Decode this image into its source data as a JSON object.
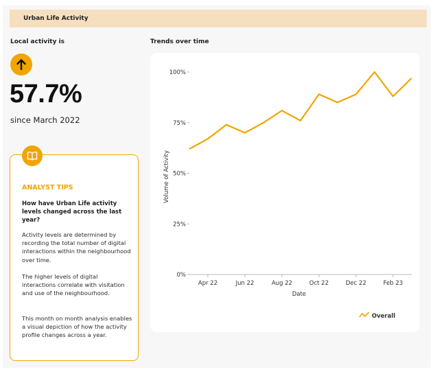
{
  "header": {
    "title": "Urban Life Activity"
  },
  "activity": {
    "label": "Local activity is",
    "direction_icon": "arrow-up-icon",
    "value": "57.7%",
    "since": "since March 2022"
  },
  "tips": {
    "icon": "book-icon",
    "title": "ANALYST TIPS",
    "question": "How have Urban Life activity levels changed across the last year?",
    "paragraphs": [
      "Activity levels are determined by recording the total number of digital interactions within the neighbourhood over time.",
      "The higher levels of digital interactions correlate with visitation and use of the neighbourhood.",
      "This month on month analysis enables a visual depiction of how the activity profile changes across a year."
    ]
  },
  "chart_section": {
    "label": "Trends over time"
  },
  "colors": {
    "accent": "#f0a500",
    "header_bg": "#f6dfbf",
    "panel_bg": "#f7f7f7"
  },
  "chart_data": {
    "type": "line",
    "xlabel": "Date",
    "ylabel": "Volume of Activity",
    "x": [
      "Mar 22",
      "Apr 22",
      "May 22",
      "Jun 22",
      "Jul 22",
      "Aug 22",
      "Sep 22",
      "Oct 22",
      "Nov 22",
      "Dec 22",
      "Jan 23",
      "Feb 23",
      "Mar 23"
    ],
    "x_ticks": [
      "Apr 22",
      "Jun 22",
      "Aug 22",
      "Oct 22",
      "Dec 22",
      "Feb 23"
    ],
    "y_ticks": [
      "100%",
      "75%",
      "50%",
      "25%",
      "0%"
    ],
    "ylim": [
      0,
      100
    ],
    "grid": false,
    "legend": "bottom-right",
    "series": [
      {
        "name": "Overall",
        "values": [
          62,
          67,
          74,
          70,
          75,
          81,
          76,
          89,
          85,
          89,
          100,
          88,
          97
        ]
      }
    ]
  }
}
